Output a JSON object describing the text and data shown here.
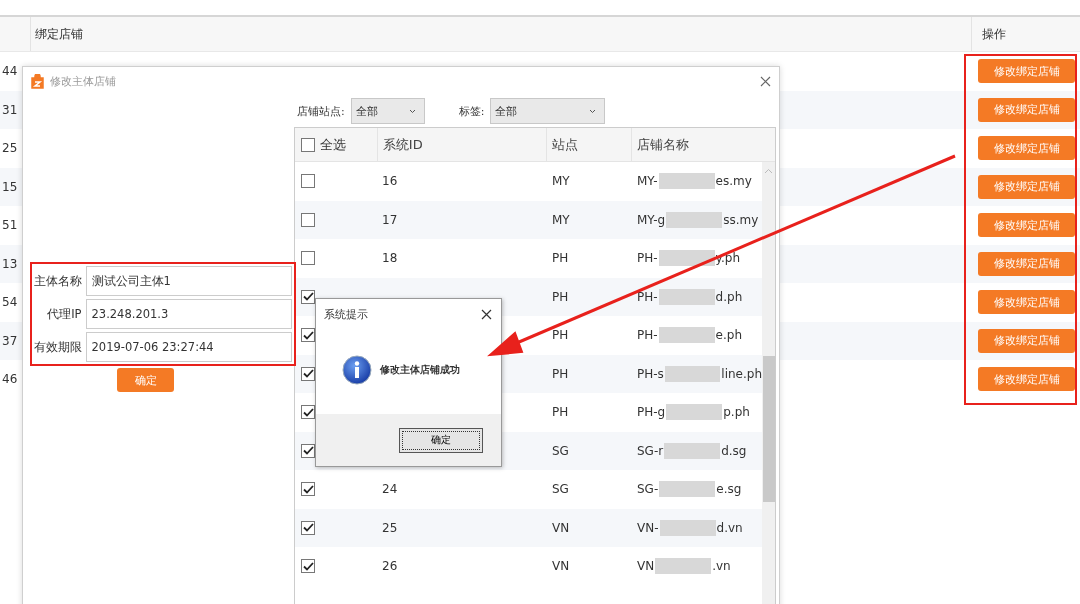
{
  "background_table": {
    "columns": [
      "绑定店铺",
      "操作"
    ],
    "rows": [
      {
        "column_1": "44",
        "action": "修改绑定店铺"
      },
      {
        "column_1": "31",
        "action": "修改绑定店铺"
      },
      {
        "column_1": "25",
        "action": "修改绑定店铺"
      },
      {
        "column_1": "15",
        "action": "修改绑定店铺"
      },
      {
        "column_1": "51",
        "action": "修改绑定店铺"
      },
      {
        "column_1": "13",
        "action": "修改绑定店铺"
      },
      {
        "column_1": "54",
        "action": "修改绑定店铺"
      },
      {
        "column_1": "37",
        "action": "修改绑定店铺"
      },
      {
        "column_1": "46",
        "action": "修改绑定店铺"
      }
    ]
  },
  "dialog": {
    "title": "修改主体店铺",
    "filters": [
      {
        "label": "店铺站点:",
        "value": "全部"
      },
      {
        "label": "标签:",
        "value": "全部"
      }
    ],
    "grid": {
      "select_all": {
        "label": "全选",
        "checked": false
      },
      "columns": [
        "系统ID",
        "站点",
        "店铺名称"
      ],
      "rows": [
        {
          "checked": false,
          "id": "16",
          "site": "MY",
          "name_start": "MY-",
          "name_end": "es.my"
        },
        {
          "checked": false,
          "id": "17",
          "site": "MY",
          "name_start": "MY-g",
          "name_end": "ss.my"
        },
        {
          "checked": false,
          "id": "18",
          "site": "PH",
          "name_start": "PH-",
          "name_end": "y.ph"
        },
        {
          "checked": true,
          "site": "PH",
          "name_start": "PH-",
          "name_end": "d.ph"
        },
        {
          "checked": true,
          "site": "PH",
          "name_start": "PH-",
          "name_end": "e.ph"
        },
        {
          "checked": true,
          "site": "PH",
          "name_start": "PH-s",
          "name_end": "line.ph"
        },
        {
          "checked": true,
          "site": "PH",
          "name_start": "PH-g",
          "name_end": "p.ph"
        },
        {
          "checked": true,
          "site": "SG",
          "name_start": "SG-r",
          "name_end": "d.sg"
        },
        {
          "checked": true,
          "id": "24",
          "site": "SG",
          "name_start": "SG-",
          "name_end": "e.sg"
        },
        {
          "checked": true,
          "id": "25",
          "site": "VN",
          "name_start": "VN-",
          "name_end": "d.vn"
        },
        {
          "checked": true,
          "id": "26",
          "site": "VN",
          "name_start": "VN",
          "name_end": ".vn"
        }
      ]
    },
    "form": {
      "fields": [
        {
          "label": "主体名称",
          "value": "测试公司主体1"
        },
        {
          "label": "代理IP",
          "value": "23.248.201.3"
        },
        {
          "label": "有效期限",
          "value": "2019-07-06 23:27:44"
        }
      ],
      "submit": "确定"
    }
  },
  "message_box": {
    "title": "系统提示",
    "message": "修改主体店铺成功",
    "button": "确定"
  }
}
